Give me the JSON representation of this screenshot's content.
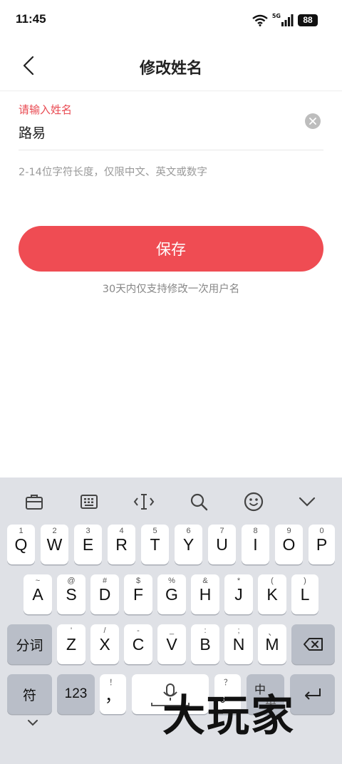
{
  "status": {
    "time": "11:45",
    "network": "5G",
    "battery": "88"
  },
  "header": {
    "title": "修改姓名"
  },
  "form": {
    "label": "请输入姓名",
    "value": "路易",
    "hint": "2-14位字符长度，仅限中文、英文或数字",
    "save_label": "保存",
    "save_note": "30天内仅支持修改一次用户名"
  },
  "keyboard": {
    "toolbar": [
      "toolbox-icon",
      "keyboard-icon",
      "text-cursor-icon",
      "search-icon",
      "emoji-icon",
      "collapse-chevron-icon"
    ],
    "row1": [
      {
        "k": "Q",
        "s": "1"
      },
      {
        "k": "W",
        "s": "2"
      },
      {
        "k": "E",
        "s": "3"
      },
      {
        "k": "R",
        "s": "4"
      },
      {
        "k": "T",
        "s": "5"
      },
      {
        "k": "Y",
        "s": "6"
      },
      {
        "k": "U",
        "s": "7"
      },
      {
        "k": "I",
        "s": "8"
      },
      {
        "k": "O",
        "s": "9"
      },
      {
        "k": "P",
        "s": "0"
      }
    ],
    "row2": [
      {
        "k": "A",
        "s": "~"
      },
      {
        "k": "S",
        "s": "@"
      },
      {
        "k": "D",
        "s": "#"
      },
      {
        "k": "F",
        "s": "$"
      },
      {
        "k": "G",
        "s": "%"
      },
      {
        "k": "H",
        "s": "&"
      },
      {
        "k": "J",
        "s": "*"
      },
      {
        "k": "K",
        "s": "("
      },
      {
        "k": "L",
        "s": ")"
      }
    ],
    "row3": [
      {
        "k": "Z",
        "s": "'"
      },
      {
        "k": "X",
        "s": "/"
      },
      {
        "k": "C",
        "s": "-"
      },
      {
        "k": "V",
        "s": "_"
      },
      {
        "k": "B",
        "s": ":"
      },
      {
        "k": "N",
        "s": ";"
      },
      {
        "k": "M",
        "s": "、"
      }
    ],
    "segment_label": "分词",
    "symbols_label": "符",
    "numbers_label": "123",
    "comma": {
      "k": "，",
      "s": "！"
    },
    "period": {
      "k": "。",
      "s": "？"
    },
    "lang_top": "中",
    "lang_bottom": "英"
  },
  "watermark": "大玩家"
}
